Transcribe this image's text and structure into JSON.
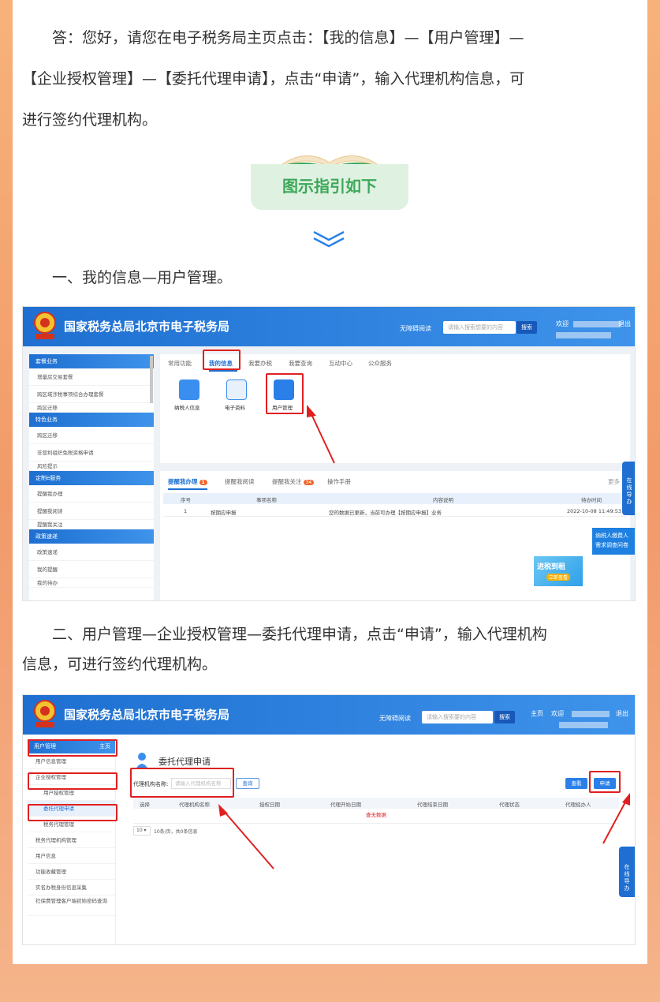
{
  "intro": {
    "line1": "答：您好，请您在电子税务局主页点击：【我的信息】—【用户管理】—",
    "line2": "【企业授权管理】—【委托代理申请】，点击“申请”，输入代理机构信息，可",
    "line3": "进行签约代理机构。"
  },
  "guide_title": "图示指引如下",
  "step1": {
    "text": "一、我的信息—用户管理。"
  },
  "step2": {
    "line1": "二、用户管理—企业授权管理—委托代理申请，点击“申请”，输入代理机构",
    "line2": "信息，可进行签约代理机构。"
  },
  "shot1": {
    "site_title": "国家税务总局北京市电子税务局",
    "accessibility": "无障碍阅读",
    "search_placeholder": "请输入搜索想要的内容",
    "search_btn": "搜索",
    "welcome": "欢迎",
    "logout": "退出",
    "sidebar": [
      {
        "head": "套餐业务",
        "items": [
          "增量房交易套餐",
          "跨区域涉税事项综合办理套餐",
          "跨区迁移"
        ]
      },
      {
        "head": "特色业务",
        "items": [
          "跨区迁移",
          "非营利组织免税资格申请",
          "风险提示"
        ]
      },
      {
        "head": "定制e服务",
        "items": [
          "提醒我办理",
          "提醒我阅读",
          "提醒我关注"
        ]
      },
      {
        "head": "政策速递",
        "items": [
          "政策速递",
          "我的提醒",
          "我的待办"
        ]
      }
    ],
    "tabs": [
      "常用功能",
      "我的信息",
      "我要办税",
      "我要查询",
      "互动中心",
      "公众服务"
    ],
    "icons": [
      "纳税人信息",
      "电子资料",
      "用户管理"
    ],
    "subtabs": [
      "提醒我办理",
      "提醒我阅读",
      "提醒我关注",
      "操作手册"
    ],
    "badge1": "1",
    "badge2": "34",
    "more": "更多",
    "table_head": [
      "序号",
      "事项名称",
      "内容说明",
      "待办时间"
    ],
    "table_row": [
      "1",
      "按期应申报",
      "您的数据已更新，当前可办理【按期应申报】业务",
      "2022-10-08 11:49:53"
    ],
    "float_btn": "在线导办",
    "survey": "纳税人缴费人需求调查问卷",
    "banner_text": "进税到租",
    "banner_sub": "立即查看"
  },
  "shot2": {
    "site_title": "国家税务总局北京市电子税务局",
    "accessibility": "无障碍阅读",
    "search_placeholder": "请输入搜索要的内容",
    "search_btn": "搜索",
    "home": "主页",
    "welcome": "欢迎",
    "logout": "退出",
    "side_head": "用户管理",
    "side_home": "主页",
    "side_items": [
      "用户信息管理",
      "企业授权管理",
      "用户授权管理",
      "委托代理申请",
      "税务代理管理",
      "税务代理机构管理",
      "用户信息",
      "功能收藏管理",
      "实名办税身份信息采集",
      "社保费管理客户端初始密码查询"
    ],
    "page_title": "委托代理申请",
    "field_label": "代理机构名称:",
    "field_placeholder": "请输入代理机构名称",
    "query_btn": "查询",
    "view_btn": "查看",
    "apply_btn": "申请",
    "cols": [
      "选择",
      "代理机构名称",
      "授权日期",
      "代理开始日期",
      "代理结束日期",
      "代理状态",
      "代理经办人"
    ],
    "no_data": "查无数据",
    "pager": "10条/页，共0条信息",
    "page_size": "10",
    "float_btn": "在线导办"
  },
  "colors": {
    "accent": "#1e6fd1",
    "red": "#e02020",
    "green": "#3da85a"
  }
}
